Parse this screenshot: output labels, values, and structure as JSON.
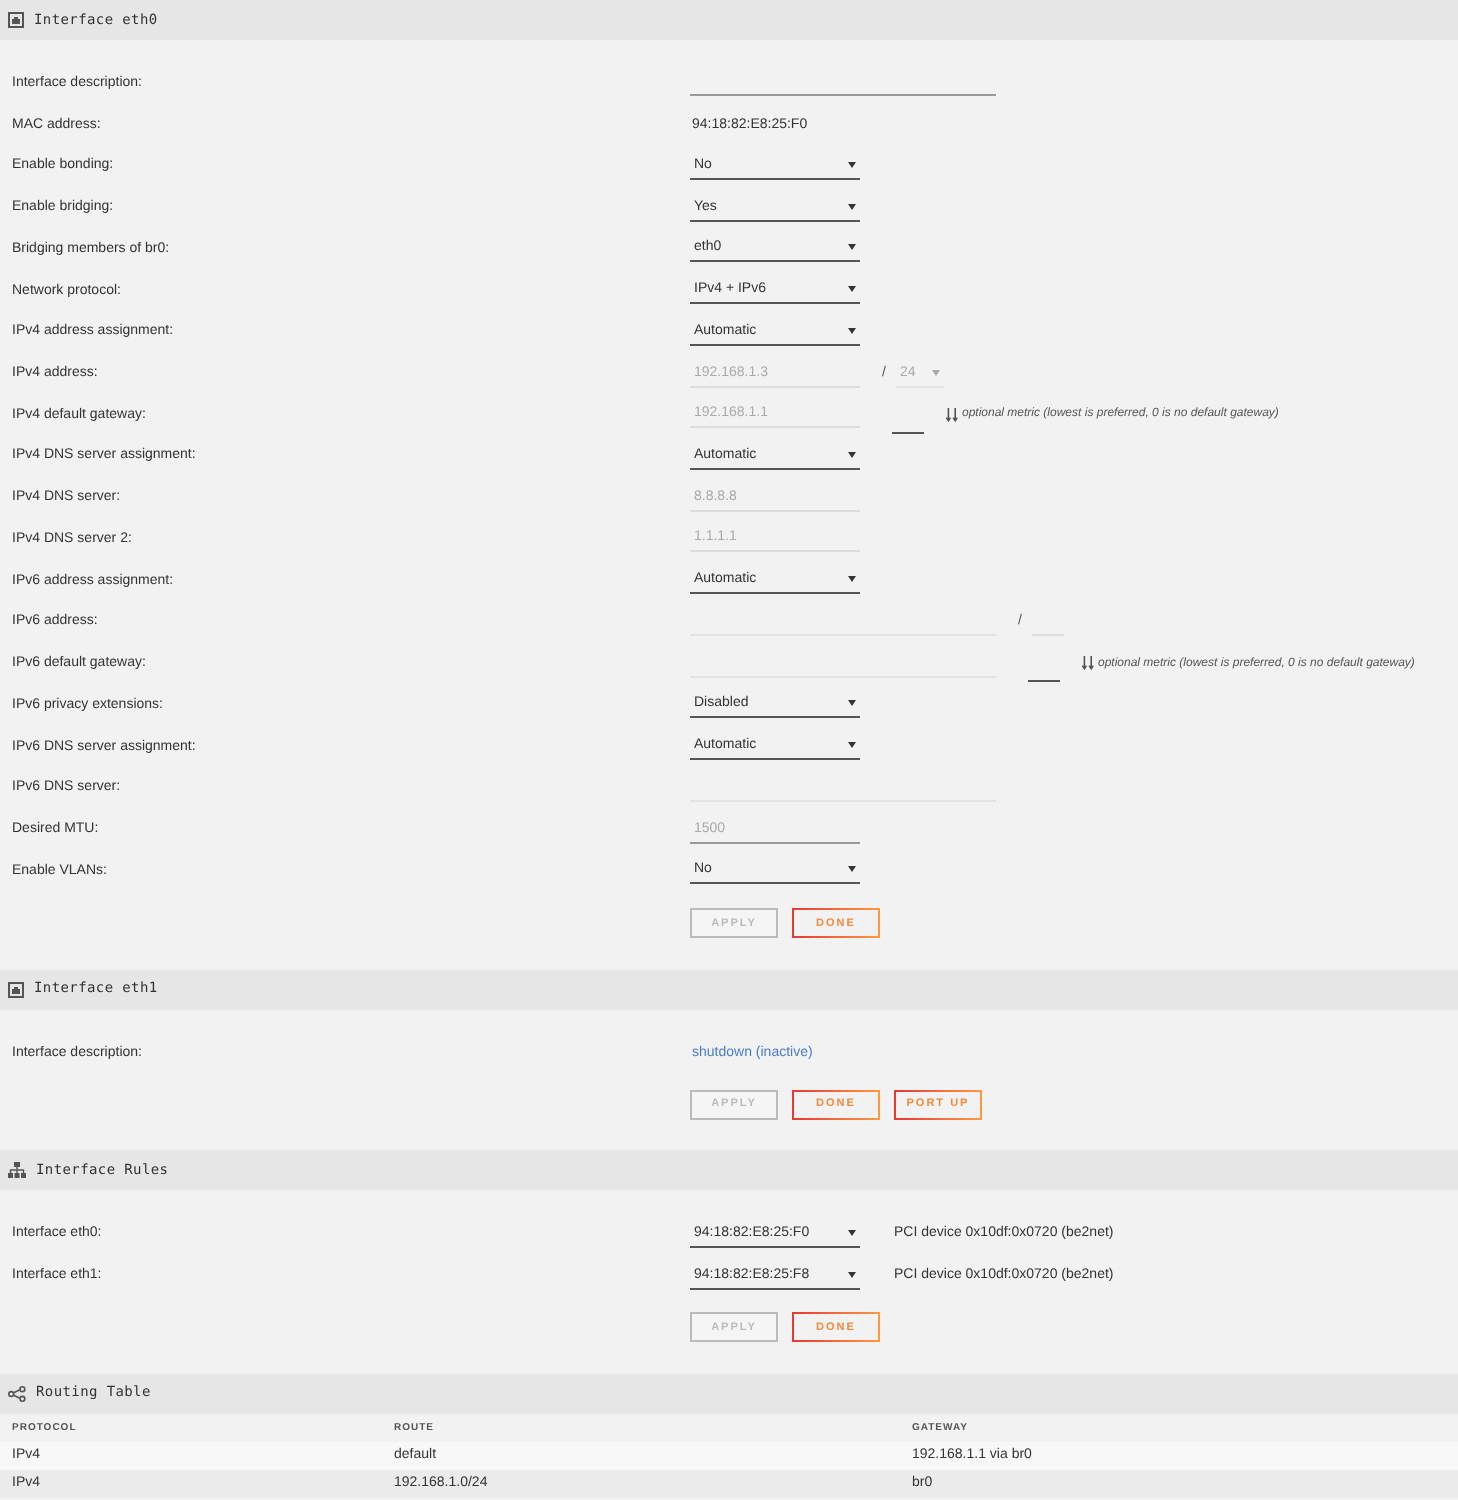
{
  "sections": [
    {
      "kind": "interface",
      "title": "Interface eth0",
      "rows": [
        {
          "label": "Interface description:",
          "controls": [
            {
              "kind": "wide_input",
              "disabled": false
            }
          ]
        },
        {
          "label": "MAC address:",
          "controls": [
            {
              "kind": "text",
              "text": "94:18:82:E8:25:F0"
            }
          ]
        },
        {
          "label": "Enable bonding:",
          "controls": [
            {
              "kind": "select",
              "value": "No",
              "disabled": false
            }
          ]
        },
        {
          "label": "Enable bridging:",
          "controls": [
            {
              "kind": "select",
              "value": "Yes",
              "disabled": false
            }
          ]
        },
        {
          "label": "Bridging members of br0:",
          "controls": [
            {
              "kind": "select",
              "value": "eth0",
              "disabled": false
            }
          ]
        },
        {
          "label": "Network protocol:",
          "controls": [
            {
              "kind": "select",
              "value": "IPv4 + IPv6",
              "disabled": false
            }
          ]
        },
        {
          "label": "IPv4 address assignment:",
          "controls": [
            {
              "kind": "select",
              "value": "Automatic",
              "disabled": false
            }
          ]
        },
        {
          "label": "IPv4 address:",
          "controls": [
            {
              "kind": "input",
              "value": "192.168.1.3",
              "disabled": true
            },
            {
              "kind": "separator",
              "text": "/"
            },
            {
              "kind": "prefix_select",
              "value": "24",
              "disabled": true
            }
          ]
        },
        {
          "label": "IPv4 default gateway:",
          "controls": [
            {
              "kind": "input",
              "value": "192.168.1.1",
              "disabled": true
            },
            {
              "kind": "small_input",
              "disabled": false
            },
            {
              "kind": "note",
              "text": "optional metric (lowest is preferred, 0 is no default gateway)"
            }
          ]
        },
        {
          "label": "IPv4 DNS server assignment:",
          "controls": [
            {
              "kind": "select",
              "value": "Automatic",
              "disabled": false
            }
          ]
        },
        {
          "label": "IPv4 DNS server:",
          "controls": [
            {
              "kind": "input",
              "value": "8.8.8.8",
              "disabled": true
            }
          ]
        },
        {
          "label": "IPv4 DNS server 2:",
          "controls": [
            {
              "kind": "input",
              "value": "1.1.1.1",
              "disabled": true
            }
          ]
        },
        {
          "label": "IPv6 address assignment:",
          "controls": [
            {
              "kind": "select",
              "value": "Automatic",
              "disabled": false
            }
          ]
        },
        {
          "label": "IPv6 address:",
          "controls": [
            {
              "kind": "wide_input",
              "disabled": true
            },
            {
              "kind": "separator",
              "text": "/"
            },
            {
              "kind": "small_input",
              "disabled": true
            }
          ]
        },
        {
          "label": "IPv6 default gateway:",
          "controls": [
            {
              "kind": "wide_input",
              "disabled": true
            },
            {
              "kind": "small_input",
              "disabled": false
            },
            {
              "kind": "note",
              "text": "optional metric (lowest is preferred, 0 is no default gateway)"
            }
          ]
        },
        {
          "label": "IPv6 privacy extensions:",
          "controls": [
            {
              "kind": "select",
              "value": "Disabled",
              "disabled": false
            }
          ]
        },
        {
          "label": "IPv6 DNS server assignment:",
          "controls": [
            {
              "kind": "select",
              "value": "Automatic",
              "disabled": false
            }
          ]
        },
        {
          "label": "IPv6 DNS server:",
          "controls": [
            {
              "kind": "wide_input",
              "disabled": true
            }
          ]
        },
        {
          "label": "Desired MTU:",
          "controls": [
            {
              "kind": "input",
              "placeholder": "1500",
              "disabled": false
            }
          ]
        },
        {
          "label": "Enable VLANs:",
          "controls": [
            {
              "kind": "select",
              "value": "No",
              "disabled": false
            }
          ]
        }
      ],
      "buttons": [
        {
          "label": "APPLY",
          "disabled": true
        },
        {
          "label": "DONE",
          "disabled": false
        }
      ]
    },
    {
      "kind": "interface",
      "title": "Interface eth1",
      "rows": [
        {
          "label": "Interface description:",
          "controls": [
            {
              "kind": "link",
              "text": "shutdown (inactive)"
            }
          ]
        }
      ],
      "buttons": [
        {
          "label": "APPLY",
          "disabled": true
        },
        {
          "label": "DONE",
          "disabled": false
        },
        {
          "label": "PORT UP",
          "disabled": false
        }
      ]
    },
    {
      "kind": "rules",
      "title": "Interface Rules",
      "rows": [
        {
          "label": "Interface eth0:",
          "controls": [
            {
              "kind": "select",
              "value": "94:18:82:E8:25:F0",
              "disabled": false
            },
            {
              "kind": "text",
              "text": "PCI device 0x10df:0x0720 (be2net)"
            }
          ]
        },
        {
          "label": "Interface eth1:",
          "controls": [
            {
              "kind": "select",
              "value": "94:18:82:E8:25:F8",
              "disabled": false
            },
            {
              "kind": "text",
              "text": "PCI device 0x10df:0x0720 (be2net)"
            }
          ]
        }
      ],
      "buttons": [
        {
          "label": "APPLY",
          "disabled": true
        },
        {
          "label": "DONE",
          "disabled": false
        }
      ]
    },
    {
      "kind": "routing",
      "title": "Routing Table",
      "table": {
        "columns": [
          "PROTOCOL",
          "ROUTE",
          "GATEWAY"
        ],
        "rows": [
          [
            "IPv4",
            "default",
            "192.168.1.1 via br0"
          ],
          [
            "IPv4",
            "192.168.1.0/24",
            "br0"
          ]
        ]
      }
    }
  ]
}
